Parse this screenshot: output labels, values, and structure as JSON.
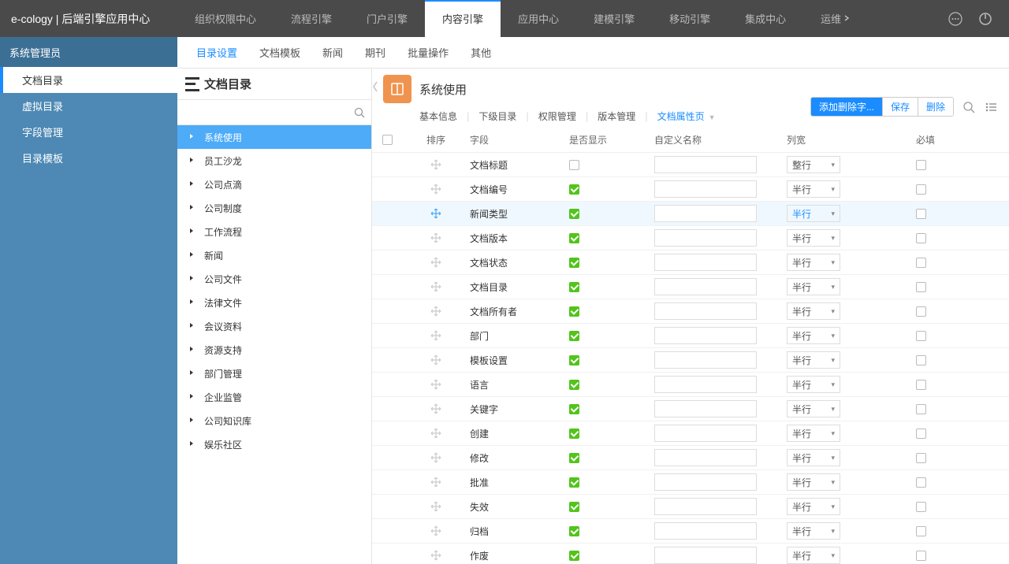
{
  "brand": "e-cology | 后端引擎应用中心",
  "topnav": [
    "组织权限中心",
    "流程引擎",
    "门户引擎",
    "内容引擎",
    "应用中心",
    "建模引擎",
    "移动引擎",
    "集成中心",
    "运维"
  ],
  "topnav_active": 3,
  "user_label": "系统管理员",
  "sidebar": [
    {
      "label": "文档目录",
      "active": true
    },
    {
      "label": "虚拟目录"
    },
    {
      "label": "字段管理"
    },
    {
      "label": "目录模板"
    }
  ],
  "subnav": [
    "目录设置",
    "文档模板",
    "新闻",
    "期刊",
    "批量操作",
    "其他"
  ],
  "subnav_active": 0,
  "tree_title": "文档目录",
  "tree_search_placeholder": "",
  "tree": [
    "系统使用",
    "员工沙龙",
    "公司点滴",
    "公司制度",
    "工作流程",
    "新闻",
    "公司文件",
    "法律文件",
    "会议资料",
    "资源支持",
    "部门管理",
    "企业监管",
    "公司知识库",
    "娱乐社区"
  ],
  "tree_active": 0,
  "detail_title": "系统使用",
  "detail_tabs": [
    "基本信息",
    "下级目录",
    "权限管理",
    "版本管理",
    "文档属性页"
  ],
  "detail_tab_active": 4,
  "buttons": {
    "add": "添加删除字...",
    "save": "保存",
    "del": "删除"
  },
  "columns": {
    "sort": "排序",
    "field": "字段",
    "show": "是否显示",
    "custom": "自定义名称",
    "width": "列宽",
    "req": "必填"
  },
  "width_full": "整行",
  "width_half": "半行",
  "rows": [
    {
      "field": "文档标题",
      "show": false,
      "width": "full",
      "req": false
    },
    {
      "field": "文档编号",
      "show": true,
      "width": "half",
      "req": false
    },
    {
      "field": "新闻类型",
      "show": true,
      "width": "half",
      "req": false,
      "hover": true
    },
    {
      "field": "文档版本",
      "show": true,
      "width": "half",
      "req": false
    },
    {
      "field": "文档状态",
      "show": true,
      "width": "half",
      "req": false
    },
    {
      "field": "文档目录",
      "show": true,
      "width": "half",
      "req": false
    },
    {
      "field": "文档所有者",
      "show": true,
      "width": "half",
      "req": false
    },
    {
      "field": "部门",
      "show": true,
      "width": "half",
      "req": false
    },
    {
      "field": "模板设置",
      "show": true,
      "width": "half",
      "req": false
    },
    {
      "field": "语言",
      "show": true,
      "width": "half",
      "req": false
    },
    {
      "field": "关键字",
      "show": true,
      "width": "half",
      "req": false
    },
    {
      "field": "创建",
      "show": true,
      "width": "half",
      "req": false
    },
    {
      "field": "修改",
      "show": true,
      "width": "half",
      "req": false
    },
    {
      "field": "批准",
      "show": true,
      "width": "half",
      "req": false
    },
    {
      "field": "失效",
      "show": true,
      "width": "half",
      "req": false
    },
    {
      "field": "归档",
      "show": true,
      "width": "half",
      "req": false
    },
    {
      "field": "作废",
      "show": true,
      "width": "half",
      "req": false
    }
  ]
}
